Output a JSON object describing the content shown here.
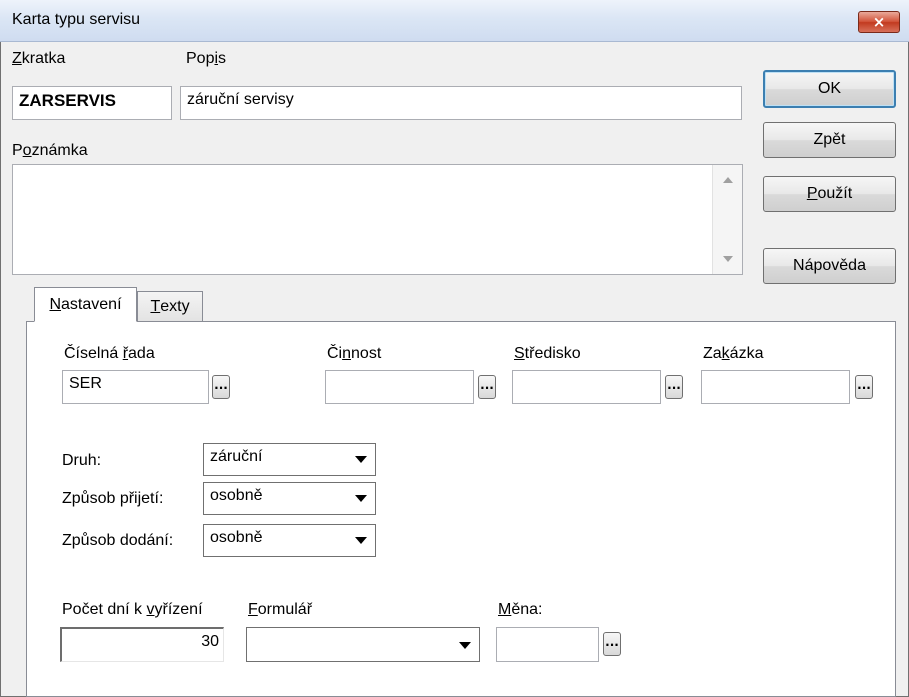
{
  "window": {
    "title": "Karta typu servisu",
    "close_label": "×"
  },
  "header": {
    "zkratka": {
      "label_pre": "",
      "label_key": "Z",
      "label_post": "kratka",
      "value": "ZARSERVIS"
    },
    "popis": {
      "label_pre": "Pop",
      "label_key": "i",
      "label_post": "s",
      "value": "záruční servisy"
    },
    "poznamka": {
      "label_pre": "P",
      "label_key": "o",
      "label_post": "známka",
      "value": ""
    }
  },
  "buttons": {
    "ok": "OK",
    "zpet": "Zpět",
    "pouzit_key": "P",
    "pouzit_rest": "oužít",
    "napoveda": "Nápověda"
  },
  "tabs": [
    {
      "key": "N",
      "rest": "astavení",
      "active": true
    },
    {
      "key": "T",
      "rest": "exty",
      "active": false
    }
  ],
  "settings": {
    "ciselna_rada": {
      "pre": "Číselná ",
      "key": "ř",
      "post": "ada",
      "value": "SER"
    },
    "cinnost": {
      "pre": "Či",
      "key": "n",
      "post": "nost",
      "value": ""
    },
    "stredisko": {
      "pre": "",
      "key": "S",
      "post": "tředisko",
      "value": ""
    },
    "zakazka": {
      "pre": "Za",
      "key": "k",
      "post": "ázka",
      "value": ""
    },
    "dots_label": "...",
    "druh": {
      "label": "Druh:",
      "value": "záruční"
    },
    "zpusob_prijeti": {
      "label": "Způsob přijetí:",
      "value": "osobně"
    },
    "zpusob_dodani": {
      "label": "Způsob dodání:",
      "value": "osobně"
    },
    "pocet_dni": {
      "pre": "Počet dní k ",
      "key": "v",
      "post": "yřízení",
      "value": "30"
    },
    "formular": {
      "pre": "",
      "key": "F",
      "post": "ormulář",
      "value": ""
    },
    "mena": {
      "pre": "",
      "key": "M",
      "post": "ěna:",
      "value": ""
    }
  }
}
